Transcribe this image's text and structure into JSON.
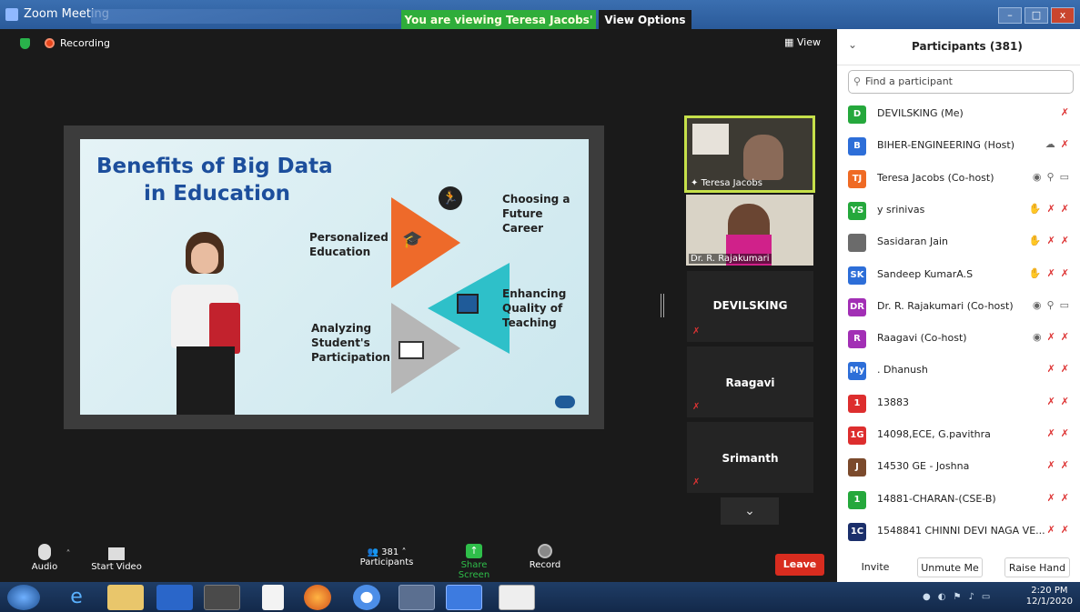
{
  "window": {
    "title": "Zoom Meeting",
    "banner": "You are viewing Teresa Jacobs' screen",
    "view_options": "View Options",
    "controls": [
      "–",
      "□",
      "x"
    ]
  },
  "meeting": {
    "recording_label": "Recording",
    "view_label": "View"
  },
  "slide": {
    "title_line1": "Benefits of Big Data",
    "title_line2": "in Education",
    "items": [
      "Choosing a Future Career",
      "Personalized Education",
      "Enhancing Quality of Teaching",
      "Analyzing Student's Participation"
    ],
    "colors": {
      "yellow": "#f5c61e",
      "orange": "#ee6a2a",
      "teal": "#2ec0c9",
      "grey": "#b6b6b6"
    }
  },
  "videos": [
    {
      "name": "Teresa Jacobs"
    },
    {
      "name": "Dr. R. Rajakumari"
    },
    {
      "name": "DEVILSKING"
    },
    {
      "name": "Raagavi"
    },
    {
      "name": "Srimanth"
    }
  ],
  "toolbar": {
    "audio": "Audio",
    "start_video": "Start Video",
    "participants_count": "381",
    "participants": "Participants",
    "share_screen": "Share Screen",
    "record": "Record",
    "leave": "Leave"
  },
  "panel": {
    "title": "Participants (381)",
    "search_placeholder": "Find a participant",
    "participants": [
      {
        "initials": "D",
        "name": "DEVILSKING (Me)",
        "color": "#25a83c"
      },
      {
        "initials": "B",
        "name": "BIHER-ENGINEERING (Host)",
        "color": "#2d6ed8"
      },
      {
        "initials": "TJ",
        "name": "Teresa Jacobs (Co-host)",
        "color": "#ef6a24"
      },
      {
        "initials": "YS",
        "name": "y srinivas",
        "color": "#25a83c"
      },
      {
        "initials": "",
        "name": "Sasidaran Jain",
        "color": "#6b6b6b"
      },
      {
        "initials": "SK",
        "name": "Sandeep KumarA.S",
        "color": "#2d6ed8"
      },
      {
        "initials": "DR",
        "name": "Dr. R. Rajakumari (Co-host)",
        "color": "#a22fb5"
      },
      {
        "initials": "R",
        "name": "Raagavi (Co-host)",
        "color": "#a22fb5"
      },
      {
        "initials": "My",
        "name": ". Dhanush",
        "color": "#2d6ed8"
      },
      {
        "initials": "1",
        "name": "13883",
        "color": "#dd2e2e"
      },
      {
        "initials": "1G",
        "name": "14098,ECE, G.pavithra",
        "color": "#dd2e2e"
      },
      {
        "initials": "J",
        "name": "14530 GE - Joshna",
        "color": "#7b4a2c"
      },
      {
        "initials": "1",
        "name": "14881-CHARAN-(CSE-B)",
        "color": "#25a83c"
      },
      {
        "initials": "1C",
        "name": "1548841 CHINNI DEVI NAGA VE...",
        "color": "#1b2f6b"
      }
    ],
    "buttons": {
      "invite": "Invite",
      "unmute": "Unmute Me",
      "raise_hand": "Raise Hand"
    }
  },
  "taskbar": {
    "time": "2:20 PM",
    "date": "12/1/2020"
  }
}
